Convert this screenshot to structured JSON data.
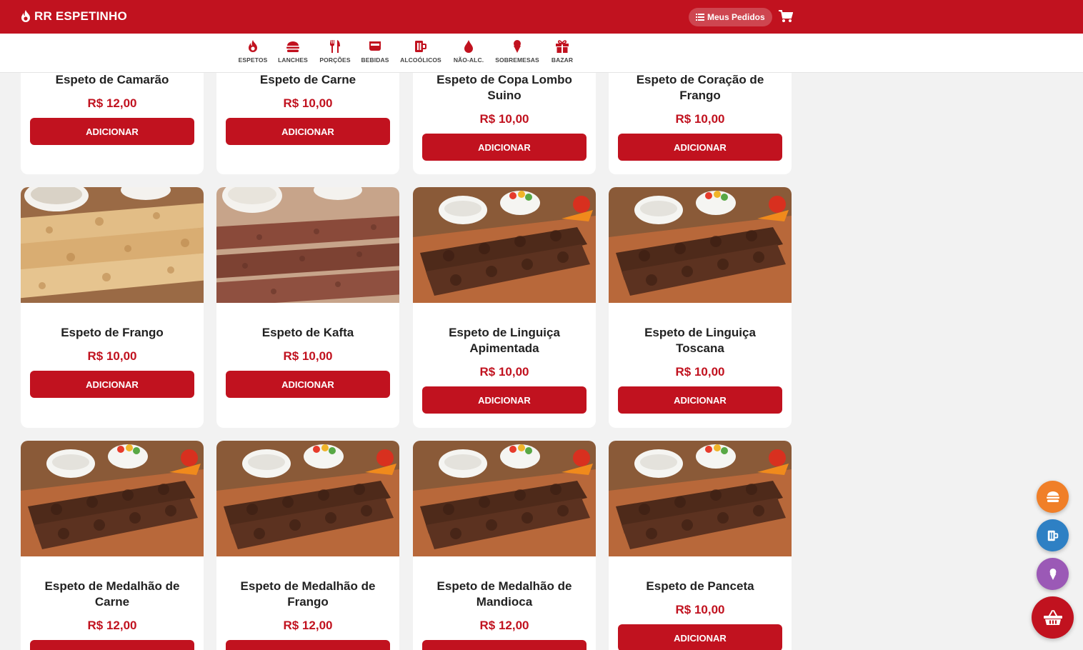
{
  "header": {
    "brand": "RR ESPETINHO",
    "orders_label": "Meus Pedidos"
  },
  "categories": [
    {
      "label": "ESPETOS",
      "icon": "fire-icon"
    },
    {
      "label": "LANCHES",
      "icon": "burger-icon"
    },
    {
      "label": "PORÇÕES",
      "icon": "utensils-icon"
    },
    {
      "label": "BEBIDAS",
      "icon": "bowl-icon"
    },
    {
      "label": "ALCOÓLICOS",
      "icon": "mug-icon"
    },
    {
      "label": "NÃO-ALC.",
      "icon": "droplet-icon"
    },
    {
      "label": "SOBREMESAS",
      "icon": "ice-cream-icon"
    },
    {
      "label": "BAZAR",
      "icon": "gift-icon"
    }
  ],
  "add_label": "ADICIONAR",
  "products": [
    {
      "name": "Espeto de Camarão",
      "price": "R$ 12,00"
    },
    {
      "name": "Espeto de Carne",
      "price": "R$ 10,00"
    },
    {
      "name": "Espeto de Copa Lombo Suino",
      "price": "R$ 10,00"
    },
    {
      "name": "Espeto de Coração de Frango",
      "price": "R$ 10,00"
    },
    {
      "name": "Espeto de Frango",
      "price": "R$ 10,00",
      "photo": "chicken"
    },
    {
      "name": "Espeto de Kafta",
      "price": "R$ 10,00",
      "photo": "kafta"
    },
    {
      "name": "Espeto de Linguiça Apimentada",
      "price": "R$ 10,00",
      "photo": "beef"
    },
    {
      "name": "Espeto de Linguiça Toscana",
      "price": "R$ 10,00",
      "photo": "beef"
    },
    {
      "name": "Espeto de Medalhão de Carne",
      "price": "R$ 12,00",
      "photo": "beef"
    },
    {
      "name": "Espeto de Medalhão de Frango",
      "price": "R$ 12,00",
      "photo": "beef"
    },
    {
      "name": "Espeto de Medalhão de Mandioca",
      "price": "R$ 12,00",
      "photo": "beef"
    },
    {
      "name": "Espeto de Panceta",
      "price": "R$ 10,00",
      "photo": "beef"
    }
  ],
  "fabs": [
    {
      "name": "fab-lanches",
      "icon": "burger-icon",
      "color": "#f07f28"
    },
    {
      "name": "fab-alcoolicos",
      "icon": "mug-icon",
      "color": "#2e80c4"
    },
    {
      "name": "fab-sobremesas",
      "icon": "ice-cream-icon",
      "color": "#9b59b6"
    },
    {
      "name": "fab-cart",
      "icon": "basket-icon",
      "color": "#c1121f"
    }
  ],
  "colors": {
    "brand": "#c1121f",
    "background": "#f2f2f2"
  }
}
